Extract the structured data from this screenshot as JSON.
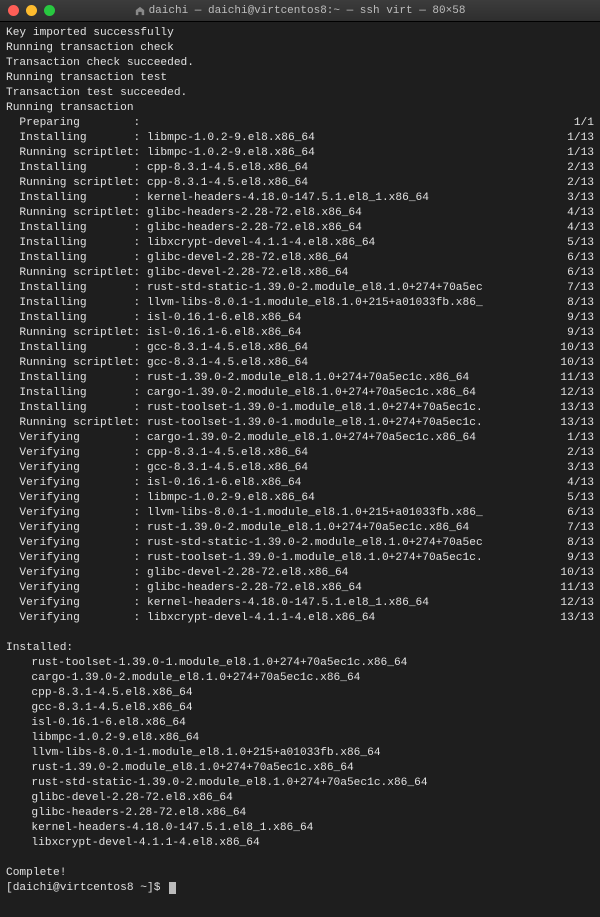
{
  "window": {
    "title": "daichi — daichi@virtcentos8:~ — ssh virt — 80×58"
  },
  "intro_lines": [
    "Key imported successfully",
    "Running transaction check",
    "Transaction check succeeded.",
    "Running transaction test",
    "Transaction test succeeded.",
    "Running transaction"
  ],
  "transaction_rows": [
    {
      "action": "Preparing",
      "pkg": "",
      "count": "1/1"
    },
    {
      "action": "Installing",
      "pkg": "libmpc-1.0.2-9.el8.x86_64",
      "count": "1/13"
    },
    {
      "action": "Running scriptlet",
      "pkg": "libmpc-1.0.2-9.el8.x86_64",
      "count": "1/13"
    },
    {
      "action": "Installing",
      "pkg": "cpp-8.3.1-4.5.el8.x86_64",
      "count": "2/13"
    },
    {
      "action": "Running scriptlet",
      "pkg": "cpp-8.3.1-4.5.el8.x86_64",
      "count": "2/13"
    },
    {
      "action": "Installing",
      "pkg": "kernel-headers-4.18.0-147.5.1.el8_1.x86_64",
      "count": "3/13"
    },
    {
      "action": "Running scriptlet",
      "pkg": "glibc-headers-2.28-72.el8.x86_64",
      "count": "4/13"
    },
    {
      "action": "Installing",
      "pkg": "glibc-headers-2.28-72.el8.x86_64",
      "count": "4/13"
    },
    {
      "action": "Installing",
      "pkg": "libxcrypt-devel-4.1.1-4.el8.x86_64",
      "count": "5/13"
    },
    {
      "action": "Installing",
      "pkg": "glibc-devel-2.28-72.el8.x86_64",
      "count": "6/13"
    },
    {
      "action": "Running scriptlet",
      "pkg": "glibc-devel-2.28-72.el8.x86_64",
      "count": "6/13"
    },
    {
      "action": "Installing",
      "pkg": "rust-std-static-1.39.0-2.module_el8.1.0+274+70a5ec",
      "count": "7/13"
    },
    {
      "action": "Installing",
      "pkg": "llvm-libs-8.0.1-1.module_el8.1.0+215+a01033fb.x86_",
      "count": "8/13"
    },
    {
      "action": "Installing",
      "pkg": "isl-0.16.1-6.el8.x86_64",
      "count": "9/13"
    },
    {
      "action": "Running scriptlet",
      "pkg": "isl-0.16.1-6.el8.x86_64",
      "count": "9/13"
    },
    {
      "action": "Installing",
      "pkg": "gcc-8.3.1-4.5.el8.x86_64",
      "count": "10/13"
    },
    {
      "action": "Running scriptlet",
      "pkg": "gcc-8.3.1-4.5.el8.x86_64",
      "count": "10/13"
    },
    {
      "action": "Installing",
      "pkg": "rust-1.39.0-2.module_el8.1.0+274+70a5ec1c.x86_64",
      "count": "11/13"
    },
    {
      "action": "Installing",
      "pkg": "cargo-1.39.0-2.module_el8.1.0+274+70a5ec1c.x86_64",
      "count": "12/13"
    },
    {
      "action": "Installing",
      "pkg": "rust-toolset-1.39.0-1.module_el8.1.0+274+70a5ec1c.",
      "count": "13/13"
    },
    {
      "action": "Running scriptlet",
      "pkg": "rust-toolset-1.39.0-1.module_el8.1.0+274+70a5ec1c.",
      "count": "13/13"
    },
    {
      "action": "Verifying",
      "pkg": "cargo-1.39.0-2.module_el8.1.0+274+70a5ec1c.x86_64",
      "count": "1/13"
    },
    {
      "action": "Verifying",
      "pkg": "cpp-8.3.1-4.5.el8.x86_64",
      "count": "2/13"
    },
    {
      "action": "Verifying",
      "pkg": "gcc-8.3.1-4.5.el8.x86_64",
      "count": "3/13"
    },
    {
      "action": "Verifying",
      "pkg": "isl-0.16.1-6.el8.x86_64",
      "count": "4/13"
    },
    {
      "action": "Verifying",
      "pkg": "libmpc-1.0.2-9.el8.x86_64",
      "count": "5/13"
    },
    {
      "action": "Verifying",
      "pkg": "llvm-libs-8.0.1-1.module_el8.1.0+215+a01033fb.x86_",
      "count": "6/13"
    },
    {
      "action": "Verifying",
      "pkg": "rust-1.39.0-2.module_el8.1.0+274+70a5ec1c.x86_64",
      "count": "7/13"
    },
    {
      "action": "Verifying",
      "pkg": "rust-std-static-1.39.0-2.module_el8.1.0+274+70a5ec",
      "count": "8/13"
    },
    {
      "action": "Verifying",
      "pkg": "rust-toolset-1.39.0-1.module_el8.1.0+274+70a5ec1c.",
      "count": "9/13"
    },
    {
      "action": "Verifying",
      "pkg": "glibc-devel-2.28-72.el8.x86_64",
      "count": "10/13"
    },
    {
      "action": "Verifying",
      "pkg": "glibc-headers-2.28-72.el8.x86_64",
      "count": "11/13"
    },
    {
      "action": "Verifying",
      "pkg": "kernel-headers-4.18.0-147.5.1.el8_1.x86_64",
      "count": "12/13"
    },
    {
      "action": "Verifying",
      "pkg": "libxcrypt-devel-4.1.1-4.el8.x86_64",
      "count": "13/13"
    }
  ],
  "installed_header": "Installed:",
  "installed_list": [
    "rust-toolset-1.39.0-1.module_el8.1.0+274+70a5ec1c.x86_64",
    "cargo-1.39.0-2.module_el8.1.0+274+70a5ec1c.x86_64",
    "cpp-8.3.1-4.5.el8.x86_64",
    "gcc-8.3.1-4.5.el8.x86_64",
    "isl-0.16.1-6.el8.x86_64",
    "libmpc-1.0.2-9.el8.x86_64",
    "llvm-libs-8.0.1-1.module_el8.1.0+215+a01033fb.x86_64",
    "rust-1.39.0-2.module_el8.1.0+274+70a5ec1c.x86_64",
    "rust-std-static-1.39.0-2.module_el8.1.0+274+70a5ec1c.x86_64",
    "glibc-devel-2.28-72.el8.x86_64",
    "glibc-headers-2.28-72.el8.x86_64",
    "kernel-headers-4.18.0-147.5.1.el8_1.x86_64",
    "libxcrypt-devel-4.1.1-4.el8.x86_64"
  ],
  "complete": "Complete!",
  "prompt": "[daichi@virtcentos8 ~]$"
}
